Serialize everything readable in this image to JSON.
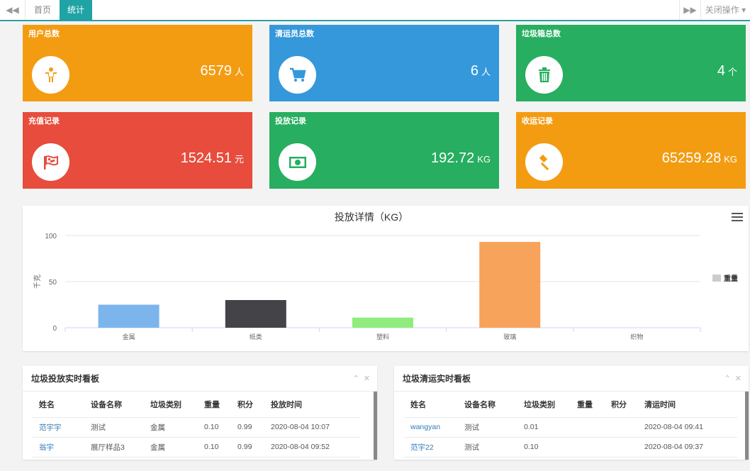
{
  "tabbar": {
    "back_icon": "rewind-icon",
    "tabs": [
      {
        "label": "首页"
      },
      {
        "label": "统计"
      }
    ],
    "forward_icon": "fast-forward-icon",
    "close_label": "关闭操作"
  },
  "cards": [
    {
      "title": "用户总数",
      "value": "6579",
      "unit": "人",
      "icon": "person-icon",
      "color": "#f39c12"
    },
    {
      "title": "清运员总数",
      "value": "6",
      "unit": "人",
      "icon": "cart-icon",
      "color": "#3498db"
    },
    {
      "title": "垃圾箱总数",
      "value": "4",
      "unit": "个",
      "icon": "trash-icon",
      "color": "#27ae60"
    },
    {
      "title": "充值记录",
      "value": "1524.51",
      "unit": "元",
      "icon": "flag-icon",
      "color": "#e74c3c"
    },
    {
      "title": "投放记录",
      "value": "192.72",
      "unit": "KG",
      "icon": "money-icon",
      "color": "#27ae60"
    },
    {
      "title": "收运记录",
      "value": "65259.28",
      "unit": "KG",
      "icon": "gavel-icon",
      "color": "#f39c12"
    }
  ],
  "chart_data": {
    "type": "bar",
    "title": "投放详情（KG）",
    "ylabel": "千克",
    "xlabel": "",
    "categories": [
      "金属",
      "纸类",
      "塑料",
      "玻璃",
      "织物"
    ],
    "series": [
      {
        "name": "重量",
        "values": [
          25,
          30,
          11,
          93,
          0
        ],
        "colors": [
          "#7cb5ec",
          "#434348",
          "#90ed7d",
          "#f7a35c",
          "#8085e9"
        ]
      }
    ],
    "ylim": [
      0,
      100
    ],
    "yticks": [
      0,
      50,
      100
    ],
    "grid": true,
    "legend": "right"
  },
  "boards": {
    "drop": {
      "title": "垃圾投放实时看板",
      "columns": [
        "姓名",
        "设备名称",
        "垃圾类别",
        "重量",
        "积分",
        "投放时间"
      ],
      "rows": [
        [
          "范宇宇",
          "测试",
          "金属",
          "0.10",
          "0.99",
          "2020-08-04 10:07"
        ],
        [
          "翁宇",
          "展厅样品3",
          "金属",
          "0.10",
          "0.99",
          "2020-08-04 09:52"
        ]
      ]
    },
    "collect": {
      "title": "垃圾清运实时看板",
      "columns": [
        "姓名",
        "设备名称",
        "垃圾类别",
        "重量",
        "积分",
        "清运时间"
      ],
      "rows": [
        [
          "wangyan",
          "测试",
          "0.01",
          "",
          "",
          "2020-08-04 09:41"
        ],
        [
          "范宇22",
          "测试",
          "0.10",
          "",
          "",
          "2020-08-04 09:37"
        ]
      ]
    },
    "collapse_icon": "chevron-up-icon",
    "close_icon": "close-icon"
  }
}
